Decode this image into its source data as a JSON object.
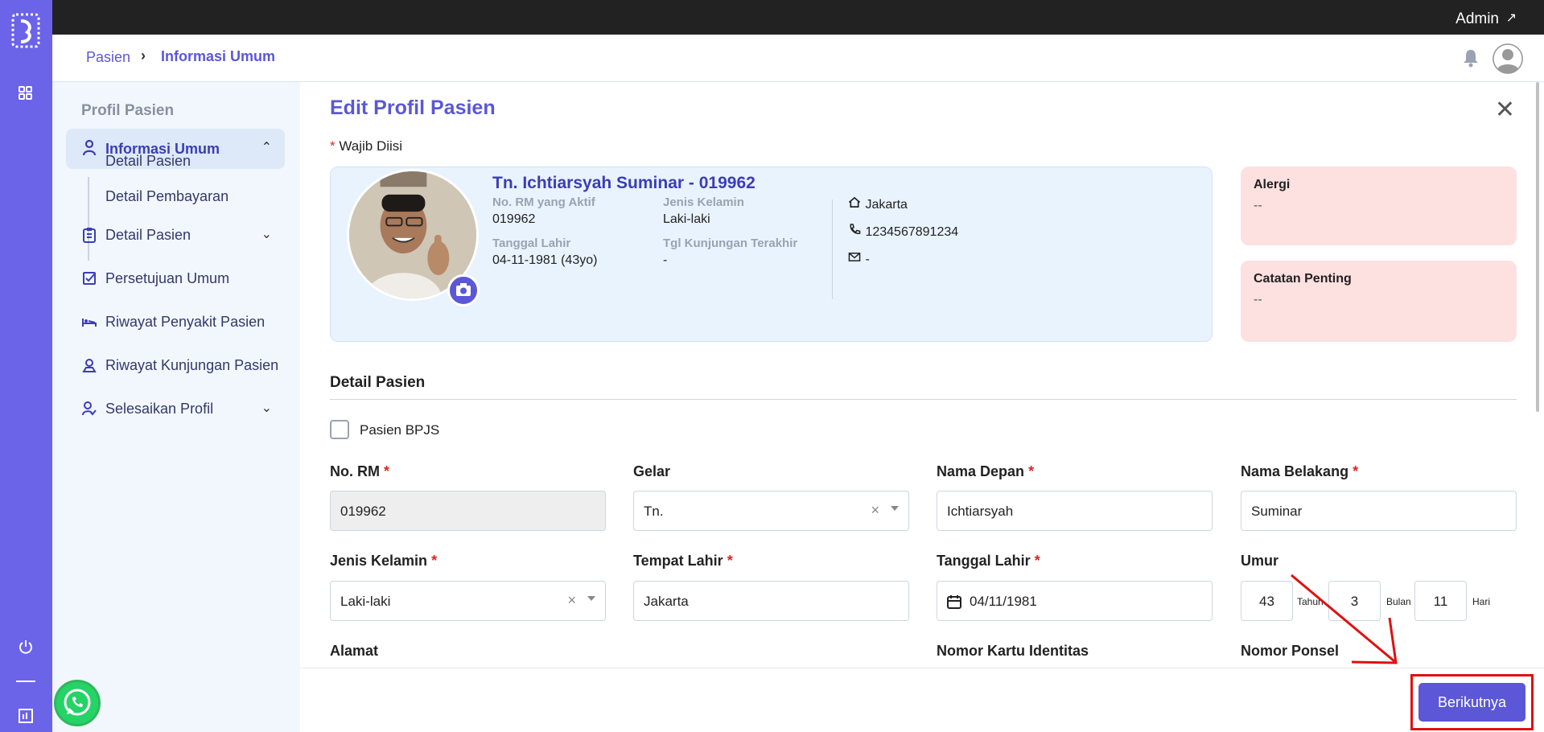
{
  "topbar": {
    "user_label": "Admin",
    "user_arrow": "↗"
  },
  "breadcrumb": {
    "parent": "Pasien",
    "separator": "›",
    "current": "Informasi Umum"
  },
  "sidenav": {
    "title": "Profil Pasien",
    "active": {
      "label": "Informasi Umum",
      "icon": "person-icon",
      "chevron": "⌃"
    },
    "subitems": [
      "Detail Pasien",
      "Detail Pembayaran"
    ],
    "items": [
      {
        "label": "Detail Pasien",
        "icon": "clipboard-icon",
        "chevron": "⌄"
      },
      {
        "label": "Persetujuan Umum",
        "icon": "checkbox-icon",
        "chevron": ""
      },
      {
        "label": "Riwayat Penyakit Pasien",
        "icon": "bed-icon",
        "chevron": ""
      },
      {
        "label": "Riwayat Kunjungan Pasien",
        "icon": "user-location-icon",
        "chevron": ""
      },
      {
        "label": "Selesaikan Profil",
        "icon": "user-check-icon",
        "chevron": "⌄"
      }
    ]
  },
  "page": {
    "title": "Edit Profil Pasien",
    "close": "✕",
    "required_star": "*",
    "required_note": "Wajib Diisi"
  },
  "patient": {
    "name": "Tn. Ichtiarsyah Suminar - 019962",
    "rm_label": "No. RM yang Aktif",
    "rm_value": "019962",
    "gender_label": "Jenis Kelamin",
    "gender_value": "Laki-laki",
    "dob_label": "Tanggal Lahir",
    "dob_value": "04-11-1981 (43yo)",
    "last_visit_label": "Tgl Kunjungan Terakhir",
    "last_visit_value": "-",
    "city": "Jakarta",
    "phone": "1234567891234",
    "email": "-"
  },
  "alerts": {
    "allergy_title": "Alergi",
    "allergy_value": "--",
    "notes_title": "Catatan Penting",
    "notes_value": "--"
  },
  "form": {
    "section_title": "Detail Pasien",
    "bpjs_label": "Pasien BPJS",
    "rm_label": "No. RM",
    "rm_value": "019962",
    "gelar_label": "Gelar",
    "gelar_value": "Tn.",
    "first_name_label": "Nama Depan",
    "first_name_value": "Ichtiarsyah",
    "last_name_label": "Nama Belakang",
    "last_name_value": "Suminar",
    "gender_label": "Jenis Kelamin",
    "gender_value": "Laki-laki",
    "birthplace_label": "Tempat Lahir",
    "birthplace_value": "Jakarta",
    "dob_label": "Tanggal Lahir",
    "dob_value": "04/11/1981",
    "age_label": "Umur",
    "age_years": "43",
    "age_years_unit": "Tahun",
    "age_months": "3",
    "age_months_unit": "Bulan",
    "age_days": "11",
    "age_days_unit": "Hari",
    "address_label": "Alamat",
    "id_card_label": "Nomor Kartu Identitas",
    "phone_label": "Nomor Ponsel",
    "clear": "×"
  },
  "footer": {
    "next_label": "Berikutnya"
  },
  "colors": {
    "accent": "#5b57d6",
    "rail": "#6b63e8",
    "alert_bg": "#fde0e0",
    "card_bg": "#e9f3fe",
    "highlight": "#e01010"
  }
}
